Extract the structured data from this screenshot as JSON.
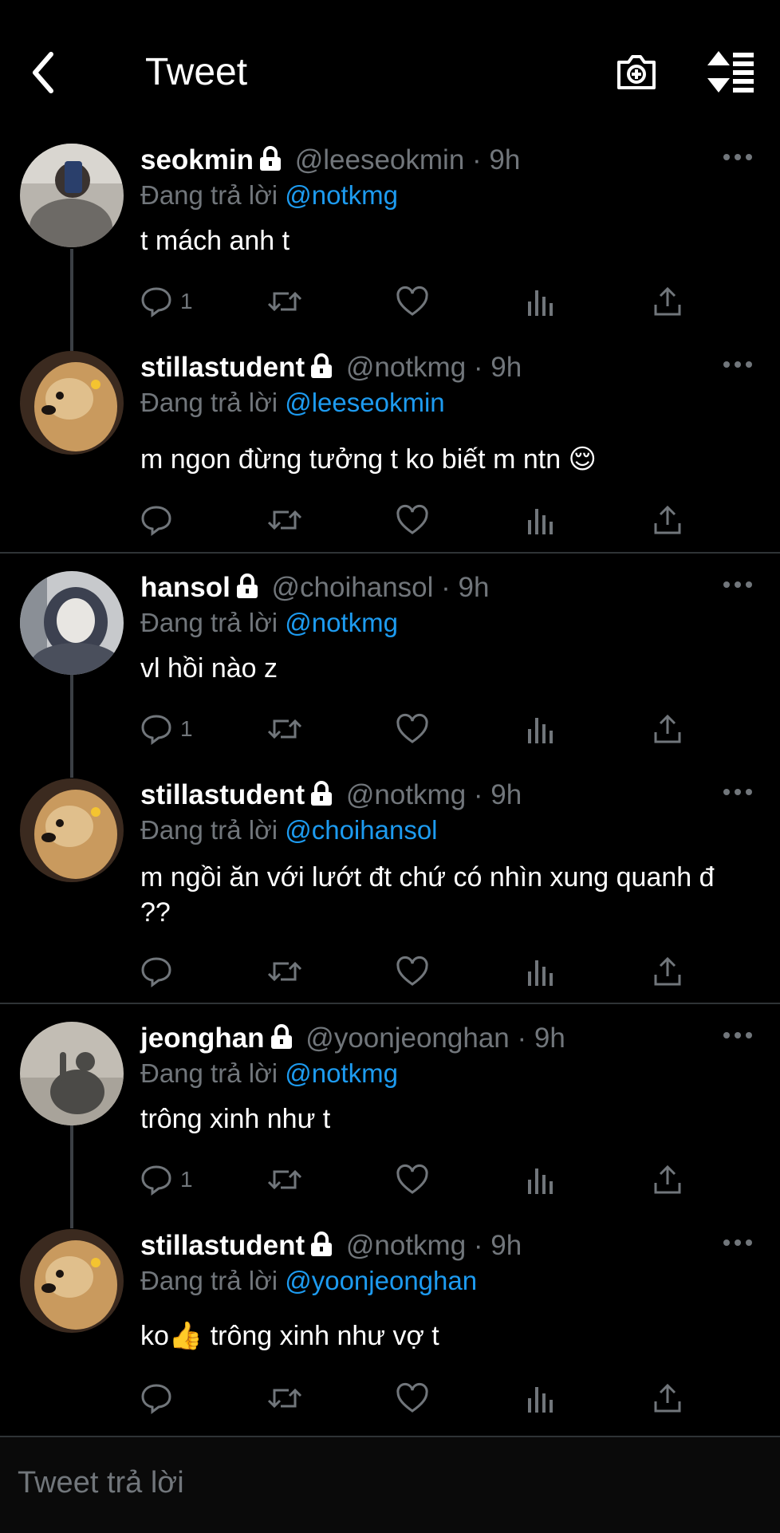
{
  "header": {
    "title": "Tweet"
  },
  "tweets": [
    {
      "name": "seokmin",
      "handle": "@leeseokmin",
      "time": "9h",
      "reply_prefix": "Đang trả lời",
      "reply_to": "@notkmg",
      "text": "t mách anh t",
      "reply_count": "1"
    },
    {
      "name": "stillastudent",
      "handle": "@notkmg",
      "time": "9h",
      "reply_prefix": "Đang trả lời",
      "reply_to": "@leeseokmin",
      "text": "m ngon đừng tưởng t ko biết m ntn 😌",
      "reply_count": ""
    },
    {
      "name": "hansol",
      "handle": "@choihansol",
      "time": "9h",
      "reply_prefix": "Đang trả lời",
      "reply_to": "@notkmg",
      "text": "vl hồi nào z",
      "reply_count": "1"
    },
    {
      "name": "stillastudent",
      "handle": "@notkmg",
      "time": "9h",
      "reply_prefix": "Đang trả lời",
      "reply_to": "@choihansol",
      "text": "m ngồi ăn với lướt đt chứ có nhìn xung quanh đ ??",
      "reply_count": ""
    },
    {
      "name": "jeonghan",
      "handle": "@yoonjeonghan",
      "time": "9h",
      "reply_prefix": "Đang trả lời",
      "reply_to": "@notkmg",
      "text": "trông xinh như t",
      "reply_count": "1"
    },
    {
      "name": "stillastudent",
      "handle": "@notkmg",
      "time": "9h",
      "reply_prefix": "Đang trả lời",
      "reply_to": "@yoonjeonghan",
      "text": "ko👍  trông xinh như vợ t",
      "reply_count": ""
    }
  ],
  "composer": {
    "placeholder": "Tweet trả lời"
  },
  "colors": {
    "background": "#000000",
    "accent": "#1d9bf0",
    "secondary_text": "#71767b",
    "divider": "#2f3336"
  },
  "icons": [
    "back-arrow-icon",
    "camera-icon",
    "sort-icon",
    "lock-icon",
    "more-icon",
    "reply-icon",
    "retweet-icon",
    "like-icon",
    "views-icon",
    "share-icon"
  ]
}
